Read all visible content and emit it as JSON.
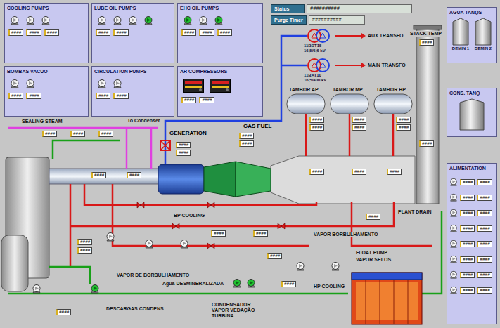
{
  "top_panels": [
    {
      "title": "COOLING PUMPS",
      "units": [
        {
          "kind": "pump",
          "running": false
        },
        {
          "kind": "pump",
          "running": false
        },
        {
          "kind": "pump",
          "running": false
        }
      ],
      "readouts": [
        "####",
        "####",
        "####"
      ]
    },
    {
      "title": "LUBE OIL PUMPS",
      "units": [
        {
          "kind": "pump",
          "running": false
        },
        {
          "kind": "pump",
          "running": false
        },
        {
          "kind": "pump",
          "running": false
        },
        {
          "kind": "pump",
          "running": true
        }
      ],
      "readouts": [
        "####",
        "####"
      ]
    },
    {
      "title": "EHC OIL PUMPS",
      "units": [
        {
          "kind": "pump",
          "running": true
        },
        {
          "kind": "pump",
          "running": false
        },
        {
          "kind": "pump",
          "running": true
        }
      ],
      "readouts": [
        "####",
        "####",
        "####"
      ]
    },
    {
      "title": "BOMBAS VACUO",
      "units": [
        {
          "kind": "pump",
          "running": false
        },
        {
          "kind": "pump",
          "running": false
        }
      ],
      "readouts": [
        "####",
        "####"
      ]
    },
    {
      "title": "CIRCULATION PUMPS",
      "units": [
        {
          "kind": "pump",
          "running": false
        },
        {
          "kind": "pump",
          "running": false
        }
      ],
      "readouts": [
        "####",
        "####"
      ]
    },
    {
      "title": "AR COMPRESSORS",
      "units": [
        {
          "kind": "compressor",
          "running": false
        },
        {
          "kind": "compressor",
          "running": false
        }
      ],
      "readouts": [
        "####",
        "####"
      ]
    }
  ],
  "status": {
    "label": "Status",
    "value": "##########"
  },
  "purge_timer": {
    "label": "Purge Timer",
    "value": "##########"
  },
  "transformers": [
    {
      "name": "11BBT15",
      "rating": "16,5/6,6 kV",
      "feeds": "AUX TRANSFO"
    },
    {
      "name": "11BAT10",
      "rating": "16,5/400 kV",
      "feeds": "MAIN TRANSFO"
    }
  ],
  "labels": [
    {
      "text": "GENERATION",
      "kind": "title"
    },
    {
      "text": "GAS FUEL",
      "kind": "title"
    },
    {
      "text": "SEALING STEAM",
      "kind": "note"
    },
    {
      "text": "To Condenser",
      "kind": "note"
    },
    {
      "text": "TAMBOR AP",
      "kind": "note"
    },
    {
      "text": "TAMBOR MP",
      "kind": "note"
    },
    {
      "text": "TAMBOR BP",
      "kind": "note"
    },
    {
      "text": "STACK TEMP",
      "kind": "note"
    },
    {
      "text": "PLANT DRAIN",
      "kind": "note"
    },
    {
      "text": "BP COOLING",
      "kind": "note"
    },
    {
      "text": "VAPOR BORBULHAMENTO",
      "kind": "note"
    },
    {
      "text": "FLOAT PUMP",
      "kind": "note"
    },
    {
      "text": "VAPOR SELOS",
      "kind": "note"
    },
    {
      "text": "HP COOLING",
      "kind": "note"
    },
    {
      "text": "VAPOR DE BORBULHAMENTO",
      "kind": "note"
    },
    {
      "text": "Agua DESMINERALIZADA",
      "kind": "note"
    },
    {
      "text": "CONDENSADOR VAPOR VEDAÇÃO TURBINA",
      "kind": "note"
    },
    {
      "text": "DESCARGAS CONDENS",
      "kind": "note"
    }
  ],
  "readouts": [
    "####",
    "####",
    "####",
    "####",
    "####",
    "####",
    "####",
    "####",
    "####",
    "####",
    "####",
    "####",
    "####",
    "####",
    "####",
    "####",
    "####",
    "####",
    "####",
    "####",
    "####",
    "####",
    "####",
    "####",
    "####",
    "####",
    "####",
    "####"
  ],
  "pumps": [
    {
      "running": false
    },
    {
      "running": true
    },
    {
      "running": true
    },
    {
      "running": true
    },
    {
      "running": false
    },
    {
      "running": false
    },
    {
      "running": false
    },
    {
      "running": false
    },
    {
      "running": false
    }
  ],
  "water_tanks": {
    "title": "AGUA TANQS",
    "tanks": [
      "DEMIN 1",
      "DEMIN 2"
    ]
  },
  "condensate_tank": {
    "title": "CONS. TANQ"
  },
  "alimentation": {
    "title": "ALIMENTATION",
    "rows": [
      {
        "running": false,
        "values": [
          "####",
          "####"
        ]
      },
      {
        "running": false,
        "values": [
          "####",
          "####"
        ]
      },
      {
        "running": false,
        "values": [
          "####",
          "####"
        ]
      },
      {
        "running": false,
        "values": [
          "####",
          "####"
        ]
      },
      {
        "running": false,
        "values": [
          "####",
          "####"
        ]
      },
      {
        "running": false,
        "values": [
          "####",
          "####"
        ]
      },
      {
        "running": false,
        "values": [
          "####",
          "####"
        ]
      },
      {
        "running": false,
        "values": [
          "####",
          "####"
        ]
      }
    ]
  }
}
